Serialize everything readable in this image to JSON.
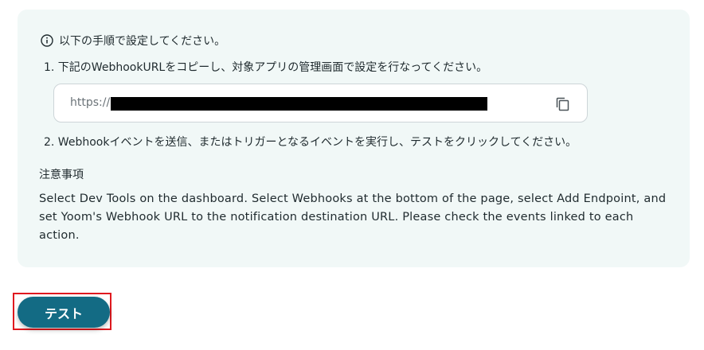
{
  "info": {
    "text": "以下の手順で設定してください。",
    "icon": "info-icon"
  },
  "steps": [
    "1. 下記のWebhookURLをコピーし、対象アプリの管理画面で設定を行なってください。",
    "2. Webhookイベントを送信、またはトリガーとなるイベントを実行し、テストをクリックしてください。"
  ],
  "webhook": {
    "url_prefix": "https://",
    "copy_icon": "copy-icon"
  },
  "notice": {
    "title": "注意事項",
    "body": "Select Dev Tools on the dashboard. Select Webhooks at the bottom of the page, select Add Endpoint, and set Yoom's Webhook URL to the notification destination URL. Please check the events linked to each action."
  },
  "test_button": {
    "label": "テスト"
  },
  "colors": {
    "panel_bg": "#f1f8f7",
    "button_bg": "#136b84",
    "highlight": "#e0191f"
  }
}
